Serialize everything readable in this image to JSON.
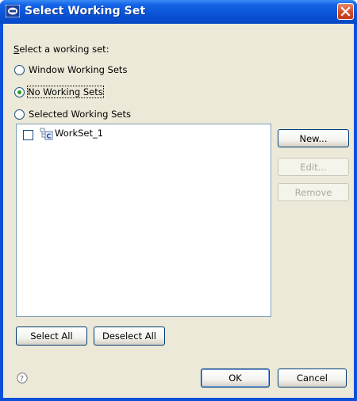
{
  "window": {
    "title": "Select Working Set"
  },
  "prompt": "Select a working set:",
  "radios": [
    {
      "label": "Window Working Sets",
      "selected": false
    },
    {
      "label": "No Working Sets",
      "selected": true
    },
    {
      "label": "Selected Working Sets",
      "selected": false
    }
  ],
  "working_sets": [
    {
      "name": "WorkSet_1",
      "checked": false,
      "icon": "working-set-icon"
    }
  ],
  "side_buttons": {
    "new": {
      "label": "New...",
      "enabled": true
    },
    "edit": {
      "label": "Edit...",
      "enabled": false
    },
    "remove": {
      "label": "Remove",
      "enabled": false
    }
  },
  "bottom_buttons": {
    "select_all": "Select All",
    "deselect_all": "Deselect All"
  },
  "footer": {
    "help_icon": "help-icon",
    "ok": "OK",
    "cancel": "Cancel"
  },
  "colors": {
    "titlebar": "#0a54d6",
    "dialog_bg": "#ece9d8",
    "close": "#d24a28",
    "radio_dot": "#21a121"
  }
}
